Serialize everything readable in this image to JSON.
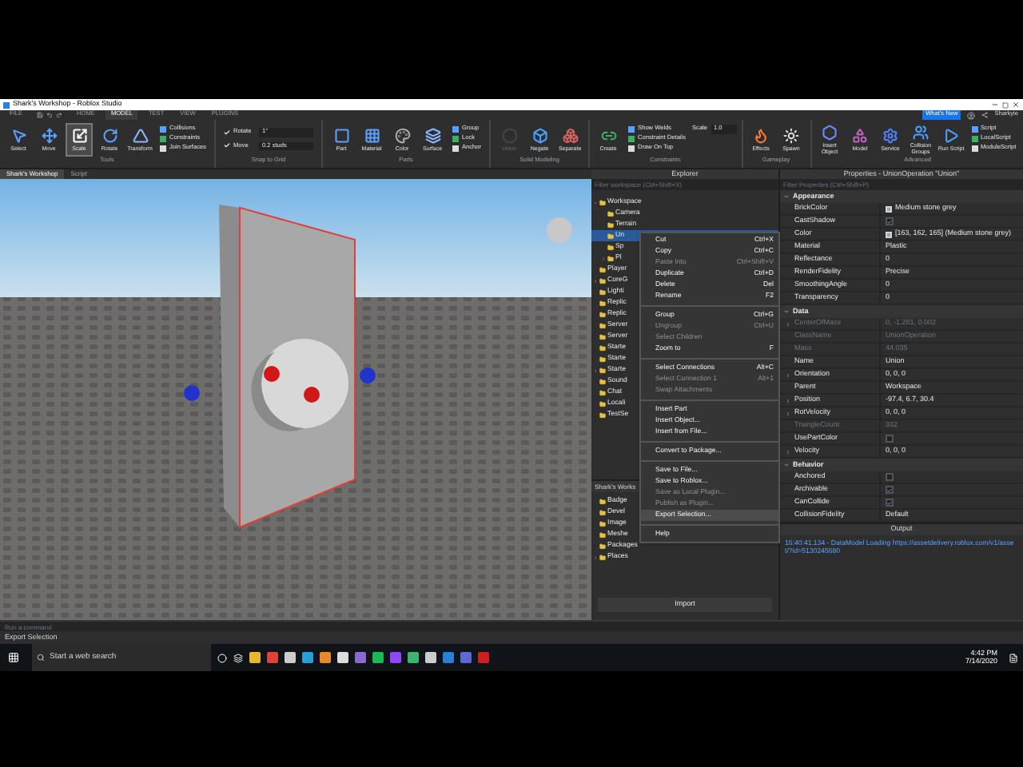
{
  "window": {
    "title": "Shark's Workshop - Roblox Studio"
  },
  "menu_tabs": [
    {
      "label": "FILE",
      "selected": false
    },
    {
      "label": "HOME",
      "selected": false
    },
    {
      "label": "MODEL",
      "selected": true
    },
    {
      "label": "TEST",
      "selected": false
    },
    {
      "label": "VIEW",
      "selected": false
    },
    {
      "label": "PLUGINS",
      "selected": false
    }
  ],
  "account": {
    "whats_new": "What's New",
    "user": "Sharkyie"
  },
  "ribbon": [
    {
      "label": "Tools",
      "items": [
        {
          "kind": "large",
          "label": "Select",
          "selected": false
        },
        {
          "kind": "large",
          "label": "Move",
          "selected": false
        },
        {
          "kind": "large",
          "label": "Scale",
          "selected": true
        },
        {
          "kind": "large",
          "label": "Rotate",
          "selected": false
        },
        {
          "kind": "large",
          "label": "Transform",
          "selected": false
        },
        {
          "kind": "stack",
          "items": [
            "Collisions",
            "Constraints",
            "Join Surfaces"
          ]
        }
      ]
    },
    {
      "label": "Snap to Grid",
      "items": [
        {
          "kind": "snap",
          "rows": [
            {
              "label": "Rotate",
              "checked": true,
              "value": "1°"
            },
            {
              "label": "Move",
              "checked": true,
              "value": "0.2 studs"
            }
          ]
        }
      ]
    },
    {
      "label": "Parts",
      "items": [
        {
          "kind": "large",
          "label": "Part",
          "selected": false
        },
        {
          "kind": "large",
          "label": "Material",
          "selected": false
        },
        {
          "kind": "large",
          "label": "Color",
          "selected": false
        },
        {
          "kind": "large",
          "label": "Surface",
          "selected": false
        },
        {
          "kind": "stack",
          "items": [
            "Group",
            "Lock",
            "Anchor"
          ]
        }
      ]
    },
    {
      "label": "Solid Modeling",
      "items": [
        {
          "kind": "large",
          "label": "Union",
          "disabled": true
        },
        {
          "kind": "large",
          "label": "Negate",
          "disabled": false
        },
        {
          "kind": "large",
          "label": "Separate",
          "disabled": false
        }
      ]
    },
    {
      "label": "Constraints",
      "items": [
        {
          "kind": "large",
          "label": "Create",
          "selected": false
        },
        {
          "kind": "stack",
          "items": [
            "Show Welds",
            "Constraint Details",
            "Draw On Top"
          ]
        },
        {
          "kind": "field",
          "label": "Scale",
          "value": "1.0"
        }
      ]
    },
    {
      "label": "Gameplay",
      "items": [
        {
          "kind": "large",
          "label": "Effects",
          "selected": false
        },
        {
          "kind": "large",
          "label": "Spawn",
          "selected": false
        }
      ]
    },
    {
      "label": "Advanced",
      "items": [
        {
          "kind": "large",
          "label": "Insert Object",
          "selected": false
        },
        {
          "kind": "large",
          "label": "Model",
          "selected": false
        },
        {
          "kind": "large",
          "label": "Service",
          "selected": false
        },
        {
          "kind": "large",
          "label": "Collision Groups",
          "selected": false
        },
        {
          "kind": "large",
          "label": "Run Script",
          "selected": false
        },
        {
          "kind": "stack",
          "items": [
            "Script",
            "LocalScript",
            "ModuleScript"
          ]
        }
      ]
    }
  ],
  "doc_tabs": [
    {
      "label": "Shark's Workshop",
      "selected": true
    },
    {
      "label": "Script",
      "selected": false
    }
  ],
  "explorer": {
    "title": "Explorer",
    "placeholder": "Filter workspace (Ctrl+Shift+X)",
    "items": [
      {
        "name": "Workspace",
        "expanded": true,
        "selected": false,
        "children": [
          {
            "name": "Camera",
            "selected": false
          },
          {
            "name": "Terrain",
            "selected": false
          },
          {
            "name": "Un",
            "selected": true
          },
          {
            "name": "Sp",
            "selected": false
          },
          {
            "name": "Pl",
            "expanded": false,
            "selected": false
          }
        ]
      },
      {
        "name": "Player",
        "selected": false
      },
      {
        "name": "CoreG",
        "expanded": false,
        "selected": false
      },
      {
        "name": "Lighti",
        "selected": false
      },
      {
        "name": "Replic",
        "selected": false
      },
      {
        "name": "Replic",
        "selected": false
      },
      {
        "name": "Server",
        "selected": false
      },
      {
        "name": "Server",
        "selected": false
      },
      {
        "name": "Starte",
        "selected": false
      },
      {
        "name": "Starte",
        "selected": false
      },
      {
        "name": "Starte",
        "expanded": false,
        "selected": false
      },
      {
        "name": "Sound",
        "selected": false
      },
      {
        "name": "Chat",
        "selected": false
      },
      {
        "name": "Locali",
        "selected": false
      },
      {
        "name": "TestSe",
        "selected": false
      }
    ]
  },
  "asset_manager": {
    "title": "Shark's Works",
    "items": [
      {
        "name": "Badge",
        "expandable": false
      },
      {
        "name": "Devel",
        "expandable": false
      },
      {
        "name": "Image",
        "expandable": false
      },
      {
        "name": "Meshe",
        "expandable": false
      },
      {
        "name": "Packages",
        "expandable": false
      },
      {
        "name": "Places",
        "expandable": true
      }
    ],
    "button": "Import"
  },
  "context_menu": [
    [
      {
        "label": "Cut",
        "shortcut": "Ctrl+X",
        "disabled": false,
        "selected": false
      },
      {
        "label": "Copy",
        "shortcut": "Ctrl+C",
        "disabled": false,
        "selected": false
      },
      {
        "label": "Paste Into",
        "shortcut": "Ctrl+Shift+V",
        "disabled": true,
        "selected": false
      },
      {
        "label": "Duplicate",
        "shortcut": "Ctrl+D",
        "disabled": false,
        "selected": false
      },
      {
        "label": "Delete",
        "shortcut": "Del",
        "disabled": false,
        "selected": false
      },
      {
        "label": "Rename",
        "shortcut": "F2",
        "disabled": false,
        "selected": false
      }
    ],
    [
      {
        "label": "Group",
        "shortcut": "Ctrl+G",
        "disabled": false,
        "selected": false
      },
      {
        "label": "Ungroup",
        "shortcut": "Ctrl+U",
        "disabled": true,
        "selected": false
      },
      {
        "label": "Select Children",
        "disabled": true,
        "selected": false
      },
      {
        "label": "Zoom to",
        "shortcut": "F",
        "disabled": false,
        "selected": false
      }
    ],
    [
      {
        "label": "Select Connections",
        "shortcut": "Alt+C",
        "disabled": false,
        "selected": false
      },
      {
        "label": "Select Connection 1",
        "shortcut": "Alt+1",
        "disabled": true,
        "selected": false
      },
      {
        "label": "Swap Attachments",
        "disabled": true,
        "selected": false
      }
    ],
    [
      {
        "label": "Insert Part",
        "disabled": false,
        "selected": false
      },
      {
        "label": "Insert Object...",
        "disabled": false,
        "selected": false
      },
      {
        "label": "Insert from File...",
        "disabled": false,
        "selected": false
      }
    ],
    [
      {
        "label": "Convert to Package...",
        "disabled": false,
        "selected": false
      }
    ],
    [
      {
        "label": "Save to File...",
        "disabled": false,
        "selected": false
      },
      {
        "label": "Save to Roblox...",
        "disabled": false,
        "selected": false
      },
      {
        "label": "Save as Local Plugin...",
        "disabled": true,
        "selected": false
      },
      {
        "label": "Publish as Plugin...",
        "disabled": true,
        "selected": false
      },
      {
        "label": "Export Selection...",
        "disabled": false,
        "selected": true
      }
    ],
    [
      {
        "label": "Help",
        "disabled": false,
        "selected": false
      }
    ]
  ],
  "properties": {
    "title": "Properties - UnionOperation \"Union\"",
    "placeholder": "Filter Properties (Ctrl+Shift+P)",
    "sections": [
      {
        "title": "Appearance",
        "expanded": true,
        "rows": [
          {
            "name": "BrickColor",
            "kind": "color",
            "value": "Medium stone grey"
          },
          {
            "name": "CastShadow",
            "kind": "check",
            "checked": true
          },
          {
            "name": "Color",
            "kind": "color",
            "value": "[163, 162, 165] (Medium stone grey)"
          },
          {
            "name": "Material",
            "kind": "text",
            "value": "Plastic"
          },
          {
            "name": "Reflectance",
            "kind": "text",
            "value": "0"
          },
          {
            "name": "RenderFidelity",
            "kind": "text",
            "value": "Precise"
          },
          {
            "name": "SmoothingAngle",
            "kind": "text",
            "value": "0"
          },
          {
            "name": "Transparency",
            "kind": "text",
            "value": "0"
          }
        ]
      },
      {
        "title": "Data",
        "expanded": true,
        "rows": [
          {
            "name": "CenterOfMass",
            "kind": "text",
            "value": "0, -1.281, 0.002",
            "disabled": true,
            "expandable": true
          },
          {
            "name": "ClassName",
            "kind": "text",
            "value": "UnionOperation",
            "disabled": true
          },
          {
            "name": "Mass",
            "kind": "text",
            "value": "44.035",
            "disabled": true
          },
          {
            "name": "Name",
            "kind": "text",
            "value": "Union"
          },
          {
            "name": "Orientation",
            "kind": "text",
            "value": "0, 0, 0",
            "expandable": true
          },
          {
            "name": "Parent",
            "kind": "text",
            "value": "Workspace"
          },
          {
            "name": "Position",
            "kind": "text",
            "value": "-97.4, 6.7, 30.4",
            "expandable": true
          },
          {
            "name": "RotVelocity",
            "kind": "text",
            "value": "0, 0, 0",
            "expandable": true
          },
          {
            "name": "TriangleCount",
            "kind": "text",
            "value": "332",
            "disabled": true
          },
          {
            "name": "UsePartColor",
            "kind": "check",
            "checked": false
          },
          {
            "name": "Velocity",
            "kind": "text",
            "value": "0, 0, 0",
            "expandable": true
          }
        ]
      },
      {
        "title": "Behavior",
        "expanded": true,
        "rows": [
          {
            "name": "Anchored",
            "kind": "check",
            "checked": false
          },
          {
            "name": "Archivable",
            "kind": "check",
            "checked": true
          },
          {
            "name": "CanCollide",
            "kind": "check",
            "checked": true
          },
          {
            "name": "CollisionFidelity",
            "kind": "text",
            "value": "Default"
          }
        ]
      }
    ]
  },
  "output": {
    "title": "Output",
    "lines": [
      "16:40:41.134 - DataModel Loading https://assetdelivery.roblox.com/v1/asset/?id=5130245680"
    ]
  },
  "command_bar": {
    "placeholder": "Run a command"
  },
  "status_bar": "Export Selection",
  "taskbar": {
    "search_placeholder": "Start a web search",
    "time": "4:42 PM",
    "date": "7/14/2020"
  }
}
